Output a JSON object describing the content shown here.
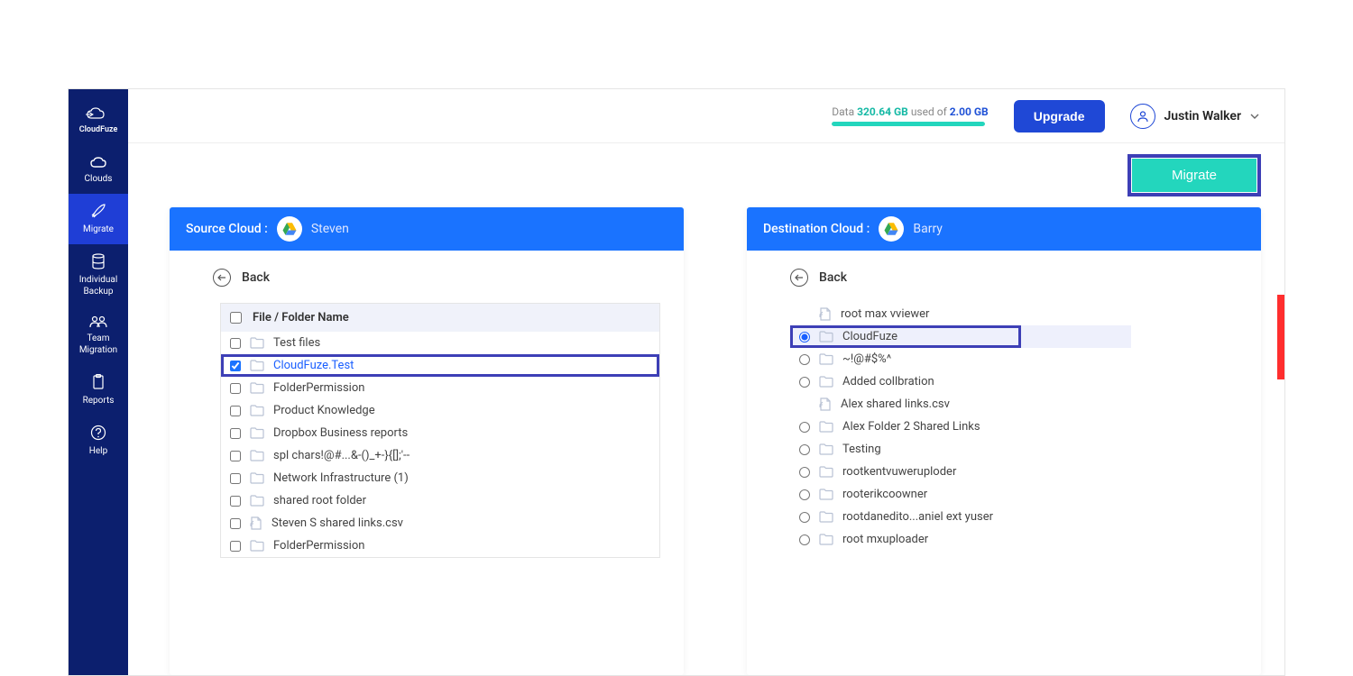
{
  "brand": {
    "name": "CloudFuze"
  },
  "sidebar": {
    "items": [
      {
        "label": "Clouds"
      },
      {
        "label": "Migrate"
      },
      {
        "label": "Individual Backup"
      },
      {
        "label": "Team Migration"
      },
      {
        "label": "Reports"
      },
      {
        "label": "Help"
      }
    ]
  },
  "topbar": {
    "data_label": "Data",
    "used_value": "320.64 GB",
    "used_of": "used of",
    "total_value": "2.00 GB",
    "upgrade_label": "Upgrade",
    "user_name": "Justin Walker"
  },
  "action": {
    "migrate_label": "Migrate"
  },
  "source": {
    "header_label": "Source Cloud :",
    "user": "Steven",
    "back": "Back",
    "column_header": "File / Folder Name",
    "rows": [
      {
        "name": "Test files",
        "checked": false,
        "type": "folder"
      },
      {
        "name": "CloudFuze.Test",
        "checked": true,
        "type": "folder"
      },
      {
        "name": "FolderPermission",
        "checked": false,
        "type": "folder"
      },
      {
        "name": "Product Knowledge",
        "checked": false,
        "type": "folder"
      },
      {
        "name": "Dropbox Business reports",
        "checked": false,
        "type": "folder"
      },
      {
        "name": "spl chars!@#...&-()_+-}{[];'--",
        "checked": false,
        "type": "folder"
      },
      {
        "name": "Network Infrastructure (1)",
        "checked": false,
        "type": "folder"
      },
      {
        "name": "shared root folder",
        "checked": false,
        "type": "folder"
      },
      {
        "name": "Steven S shared links.csv",
        "checked": false,
        "type": "file"
      },
      {
        "name": "FolderPermission",
        "checked": false,
        "type": "folder"
      }
    ]
  },
  "destination": {
    "header_label": "Destination Cloud :",
    "user": "Barry",
    "back": "Back",
    "rows": [
      {
        "name": "root max vviewer",
        "radio": false,
        "type": "file"
      },
      {
        "name": "CloudFuze",
        "radio": true,
        "type": "folder",
        "selected": true
      },
      {
        "name": "~!@#$%^",
        "radio": true,
        "type": "folder"
      },
      {
        "name": "Added collbration",
        "radio": true,
        "type": "folder"
      },
      {
        "name": "Alex shared links.csv",
        "radio": false,
        "type": "file"
      },
      {
        "name": "Alex Folder 2 Shared Links",
        "radio": true,
        "type": "folder"
      },
      {
        "name": "Testing",
        "radio": true,
        "type": "folder"
      },
      {
        "name": "rootkentvuweruploder",
        "radio": true,
        "type": "folder"
      },
      {
        "name": "rooterikcoowner",
        "radio": true,
        "type": "folder"
      },
      {
        "name": "rootdanedito...aniel ext yuser",
        "radio": true,
        "type": "folder"
      },
      {
        "name": "root mxuploader",
        "radio": true,
        "type": "folder"
      }
    ]
  }
}
